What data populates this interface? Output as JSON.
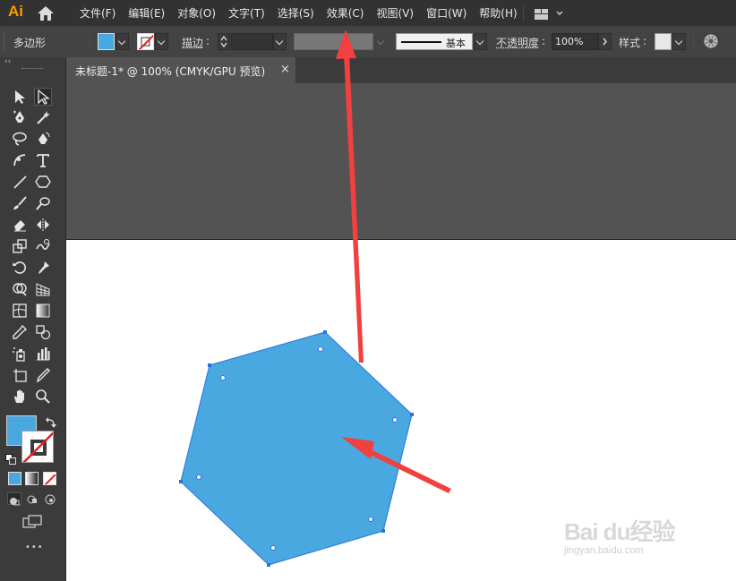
{
  "app": {
    "logo": "Ai"
  },
  "menu": [
    "文件(F)",
    "编辑(E)",
    "对象(O)",
    "文字(T)",
    "选择(S)",
    "效果(C)",
    "视图(V)",
    "窗口(W)",
    "帮助(H)"
  ],
  "control_bar": {
    "object_type": "多边形",
    "stroke_label": "描边",
    "stroke_style": "基本",
    "opacity_label": "不透明度",
    "opacity_value": "100%",
    "style_label": "样式",
    "fill_color": "#4aa8e0"
  },
  "document": {
    "tab_title": "未标题-1* @ 100% (CMYK/GPU 预览)",
    "close_glyph": "×"
  },
  "tool_panel": {
    "collapse_glyph": "‹‹",
    "more_glyph": "•••",
    "fill_color": "#4aa8e0",
    "stroke_color": "#ffffff"
  },
  "colors": {
    "polygon_fill": "#4aa8e0",
    "polygon_stroke": "#2e7fe0",
    "annotation_arrow": "#f04040"
  },
  "watermark": {
    "brand": "Bai du经验",
    "url": "jingyan.baidu.com"
  }
}
